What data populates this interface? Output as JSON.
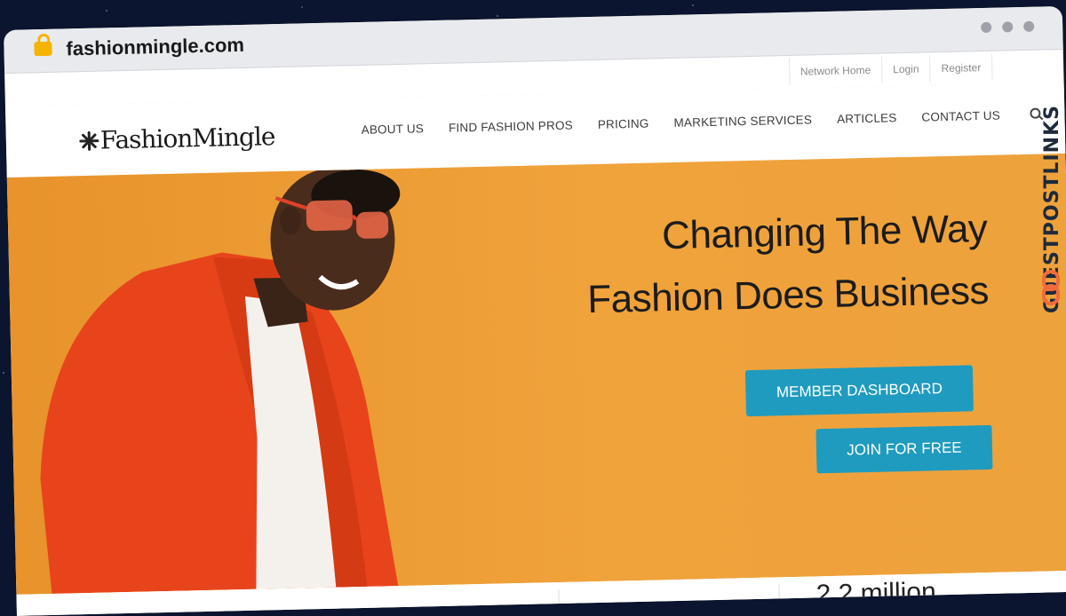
{
  "browser": {
    "url": "fashionmingle.com"
  },
  "top_links": [
    {
      "label": "Network Home"
    },
    {
      "label": "Login"
    },
    {
      "label": "Register"
    }
  ],
  "logo": {
    "text": "FashionMingle"
  },
  "nav": {
    "items": [
      {
        "label": "ABOUT US"
      },
      {
        "label": "FIND FASHION PROS"
      },
      {
        "label": "PRICING"
      },
      {
        "label": "MARKETING SERVICES"
      },
      {
        "label": "ARTICLES"
      },
      {
        "label": "CONTACT US"
      }
    ],
    "search_icon": "search-icon"
  },
  "hero": {
    "headline_line1": "Changing The Way",
    "headline_line2": "Fashion Does Business",
    "primary_button": "MEMBER DASHBOARD",
    "secondary_button": "JOIN FOR FREE"
  },
  "below": {
    "stat_partial": "2.2 million"
  },
  "watermark": {
    "text": "GUESTPOSTLINKS"
  },
  "colors": {
    "hero_bg": "#f0a23b",
    "button": "#1f9bbf",
    "lock": "#f5b400",
    "jacket": "#e8441c"
  }
}
